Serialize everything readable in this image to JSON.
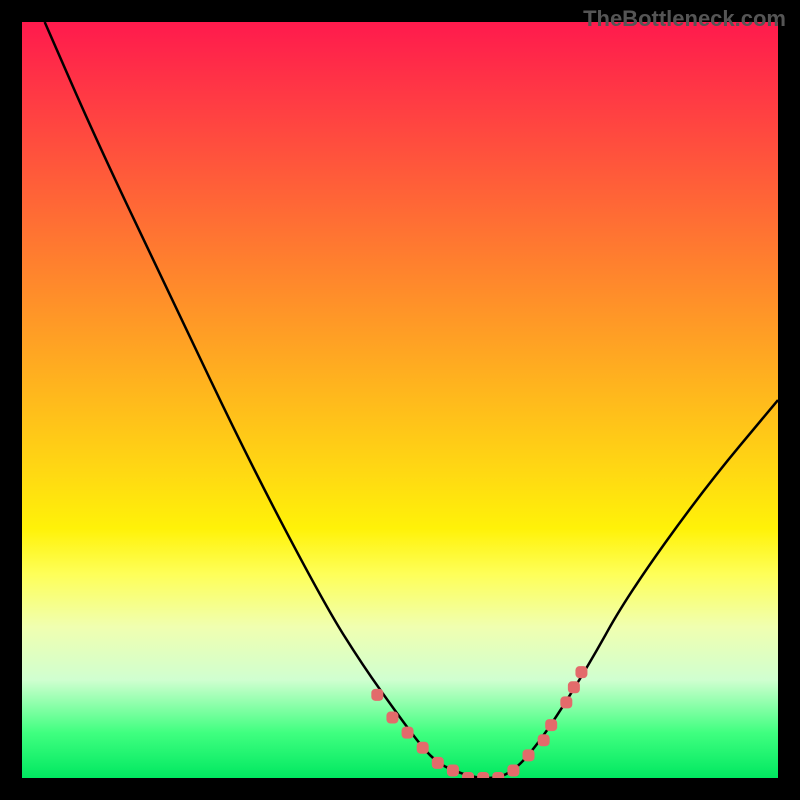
{
  "watermark": "TheBottleneck.com",
  "colors": {
    "frame": "#000000",
    "curve": "#000000",
    "dot": "#e36b6b",
    "gradient_top": "#ff1a4d",
    "gradient_mid": "#ffe600",
    "gradient_bottom": "#00e860"
  },
  "chart_data": {
    "type": "line",
    "title": "",
    "xlabel": "",
    "ylabel": "",
    "xlim": [
      0,
      100
    ],
    "ylim": [
      0,
      100
    ],
    "series": [
      {
        "name": "bottleneck-curve",
        "x": [
          3,
          10,
          20,
          30,
          40,
          45,
          50,
          53,
          55,
          57,
          60,
          63,
          65,
          67,
          70,
          75,
          80,
          90,
          100
        ],
        "y": [
          100,
          84,
          63,
          42,
          23,
          15,
          8,
          4,
          2,
          1,
          0,
          0,
          1,
          3,
          7,
          15,
          24,
          38,
          50
        ]
      }
    ],
    "highlight_points": {
      "name": "bottleneck-dots",
      "x": [
        47,
        49,
        51,
        53,
        55,
        57,
        59,
        61,
        63,
        65,
        67,
        69,
        70,
        72,
        73,
        74
      ],
      "y": [
        11,
        8,
        6,
        4,
        2,
        1,
        0,
        0,
        0,
        1,
        3,
        5,
        7,
        10,
        12,
        14
      ]
    }
  }
}
